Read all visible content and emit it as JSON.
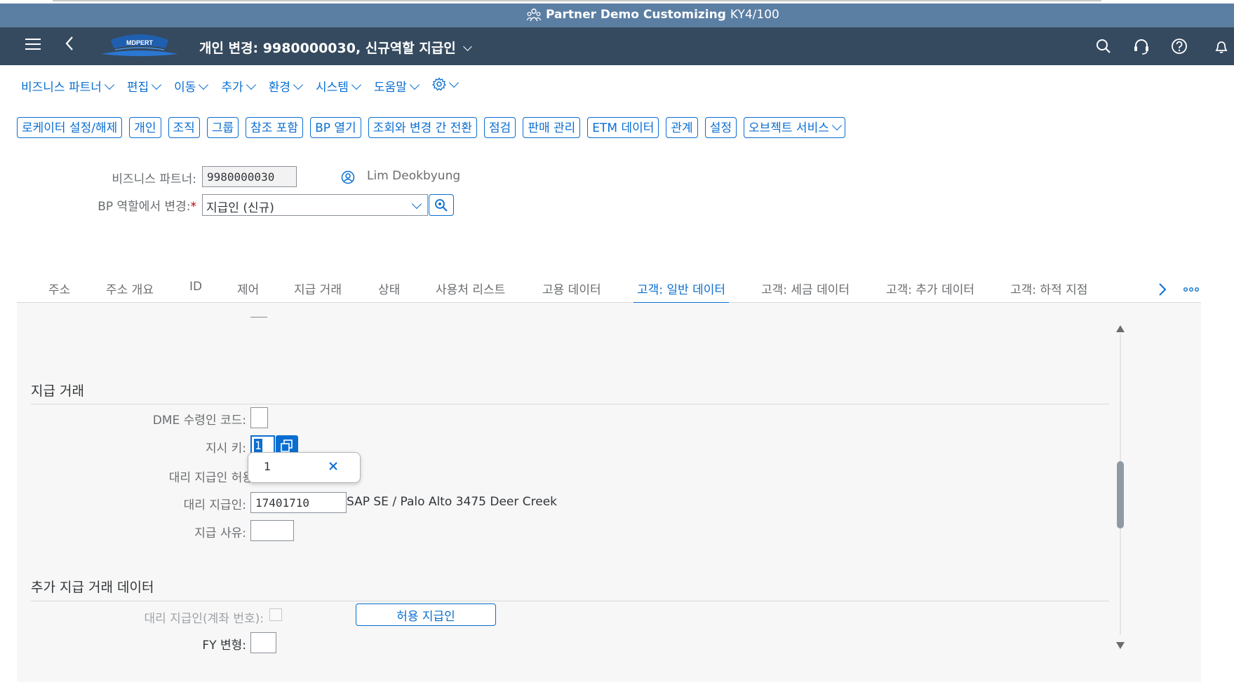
{
  "titlebar": {
    "app_name": "Partner Demo Customizing",
    "system": "KY4/100"
  },
  "shell": {
    "logo_text": "MDPERT",
    "page_title": "개인 변경: 9980000030, 신규역할 지급인"
  },
  "menu": [
    "비즈니스 파트너",
    "편집",
    "이동",
    "추가",
    "환경",
    "시스템",
    "도움말"
  ],
  "toolbar": [
    "로케이터 설정/해제",
    "개인",
    "조직",
    "그룹",
    "참조 포함",
    "BP 열기",
    "조회와 변경 간 전환",
    "점검",
    "판매 관리",
    "ETM 데이터",
    "관계",
    "설정"
  ],
  "toolbar_more": "오브젝트 서비스",
  "header": {
    "bp_label": "비즈니스 파트너:",
    "bp_value": "9980000030",
    "bp_name": "Lim Deokbyung",
    "role_label": "BP 역할에서 변경:",
    "role_required": "*",
    "role_value": "지급인 (신규)"
  },
  "tabs": [
    "주소",
    "주소 개요",
    "ID",
    "제어",
    "지급 거래",
    "상태",
    "사용처 리스트",
    "고용 데이터",
    "고객: 일반 데이터",
    "고객: 세금 데이터",
    "고객: 추가 데이터",
    "고객: 하적 지점"
  ],
  "active_tab": "고객: 일반 데이터",
  "section1": {
    "title": "지급 거래",
    "dme_label": "DME 수령인 코드:",
    "dme_value": "",
    "instr_label": "지시 키:",
    "instr_value": "1",
    "alt_allowed_label": "대리 지급인 허용",
    "alt_payer_label": "대리 지급인:",
    "alt_payer_value": "17401710",
    "alt_payer_desc": "SAP SE / Palo Alto 3475 Deer Creek",
    "reason_label": "지급 사유:",
    "reason_value": ""
  },
  "popup": {
    "value": "1"
  },
  "section2": {
    "title": "추가 지급 거래 데이터",
    "alt_acct_label": "대리 지급인(계좌 번호):",
    "allowed_button": "허용 지급인",
    "fy_label": "FY 변형:",
    "fy_value": ""
  },
  "colors": {
    "shell": "#354a5f",
    "titlebar": "#5b7ea3",
    "accent": "#0a6ed1",
    "required": "#bb0000"
  }
}
